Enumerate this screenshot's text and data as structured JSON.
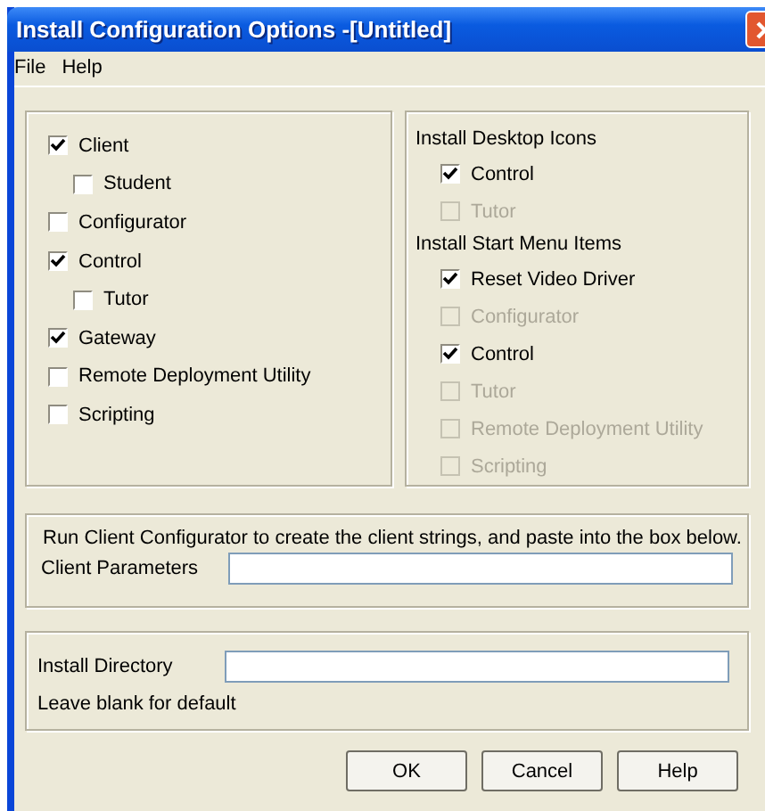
{
  "window": {
    "title": "Install Configuration Options -[Untitled]"
  },
  "menu": [
    "File",
    "Help"
  ],
  "components": [
    {
      "label": "Client",
      "checked": true,
      "children": [
        {
          "label": "Student",
          "checked": false
        }
      ]
    },
    {
      "label": "Configurator",
      "checked": false
    },
    {
      "label": "Control",
      "checked": true,
      "children": [
        {
          "label": "Tutor",
          "checked": false
        }
      ]
    },
    {
      "label": "Gateway",
      "checked": true
    },
    {
      "label": "Remote Deployment Utility",
      "checked": false
    },
    {
      "label": "Scripting",
      "checked": false
    }
  ],
  "shortcut_sections": [
    {
      "heading": "Install Desktop Icons",
      "items": [
        {
          "label": "Control",
          "checked": true,
          "disabled": false
        },
        {
          "label": "Tutor",
          "checked": false,
          "disabled": true
        }
      ]
    },
    {
      "heading": "Install Start Menu Items",
      "items": [
        {
          "label": "Reset Video Driver",
          "checked": true,
          "disabled": false
        },
        {
          "label": "Configurator",
          "checked": false,
          "disabled": true
        },
        {
          "label": "Control",
          "checked": true,
          "disabled": false
        },
        {
          "label": "Tutor",
          "checked": false,
          "disabled": true
        },
        {
          "label": "Remote Deployment Utility",
          "checked": false,
          "disabled": true
        },
        {
          "label": "Scripting",
          "checked": false,
          "disabled": true
        }
      ]
    }
  ],
  "client_group": {
    "instruction": "Run Client Configurator to create the client strings, and paste into the box below.",
    "field_label": "Client Parameters"
  },
  "directory_group": {
    "field_label": "Install Directory",
    "hint": "Leave blank for default"
  },
  "buttons": [
    "OK",
    "Cancel",
    "Help"
  ]
}
